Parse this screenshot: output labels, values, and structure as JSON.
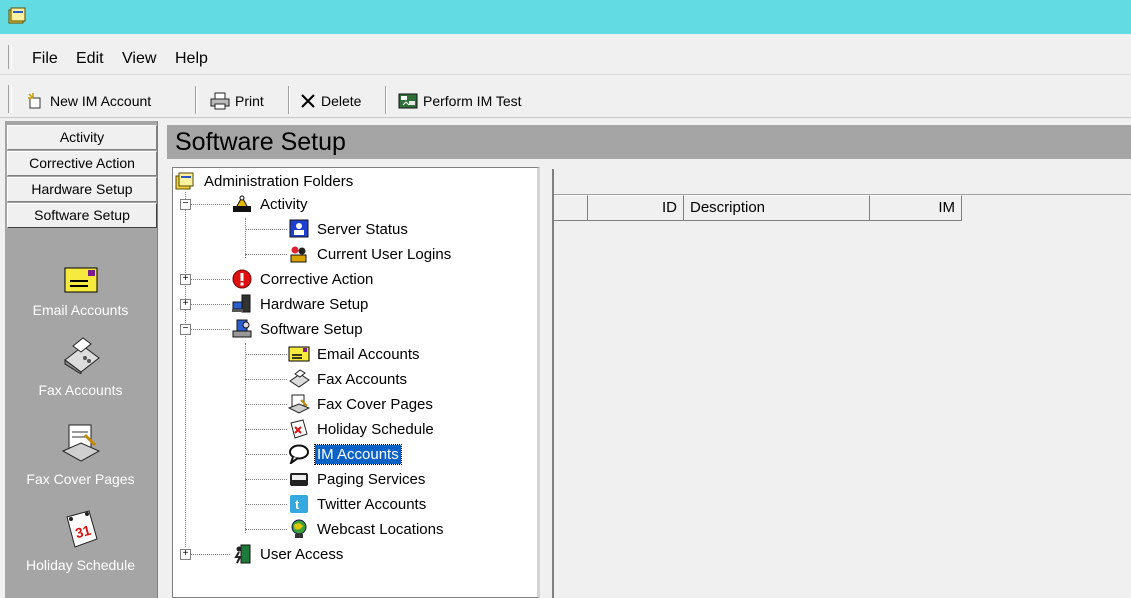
{
  "window": {
    "title": ""
  },
  "menu": {
    "file": "File",
    "edit": "Edit",
    "view": "View",
    "help": "Help"
  },
  "toolbar": {
    "new_im_account": "New IM Account",
    "print": "Print",
    "delete": "Delete",
    "perform_im_test": "Perform IM Test"
  },
  "nav_tabs": [
    "Activity",
    "Corrective Action",
    "Hardware Setup",
    "Software Setup"
  ],
  "selected_tab": "Software Setup",
  "shortcuts": [
    "Email Accounts",
    "Fax Accounts",
    "Fax Cover Pages",
    "Holiday Schedule"
  ],
  "page_title": "Software Setup",
  "tree": {
    "root": "Administration Folders",
    "items": [
      {
        "label": "Activity",
        "icon": "activity-scale-icon",
        "expanded": true
      },
      {
        "label": "Server Status",
        "icon": "server-status-icon"
      },
      {
        "label": "Current User Logins",
        "icon": "user-logins-icon"
      },
      {
        "label": "Corrective Action",
        "icon": "alert-icon",
        "expanded": false
      },
      {
        "label": "Hardware Setup",
        "icon": "computer-icon",
        "expanded": false
      },
      {
        "label": "Software Setup",
        "icon": "software-setup-icon",
        "expanded": true
      },
      {
        "label": "Email Accounts",
        "icon": "envelope-icon"
      },
      {
        "label": "Fax Accounts",
        "icon": "fax-icon"
      },
      {
        "label": "Fax Cover Pages",
        "icon": "fax-cover-icon"
      },
      {
        "label": "Holiday Schedule",
        "icon": "calendar-icon"
      },
      {
        "label": "IM Accounts",
        "icon": "speech-bubble-icon",
        "selected": true
      },
      {
        "label": "Paging Services",
        "icon": "pager-icon"
      },
      {
        "label": "Twitter Accounts",
        "icon": "twitter-icon"
      },
      {
        "label": "Webcast Locations",
        "icon": "globe-icon"
      },
      {
        "label": "User Access",
        "icon": "door-icon",
        "expanded": false
      }
    ]
  },
  "list": {
    "columns": [
      "",
      "ID",
      "Description",
      "IM"
    ]
  },
  "colors": {
    "titlebar": "#62dbe2",
    "panel_gray": "#a5a5a5",
    "selection": "#0a62c7"
  }
}
